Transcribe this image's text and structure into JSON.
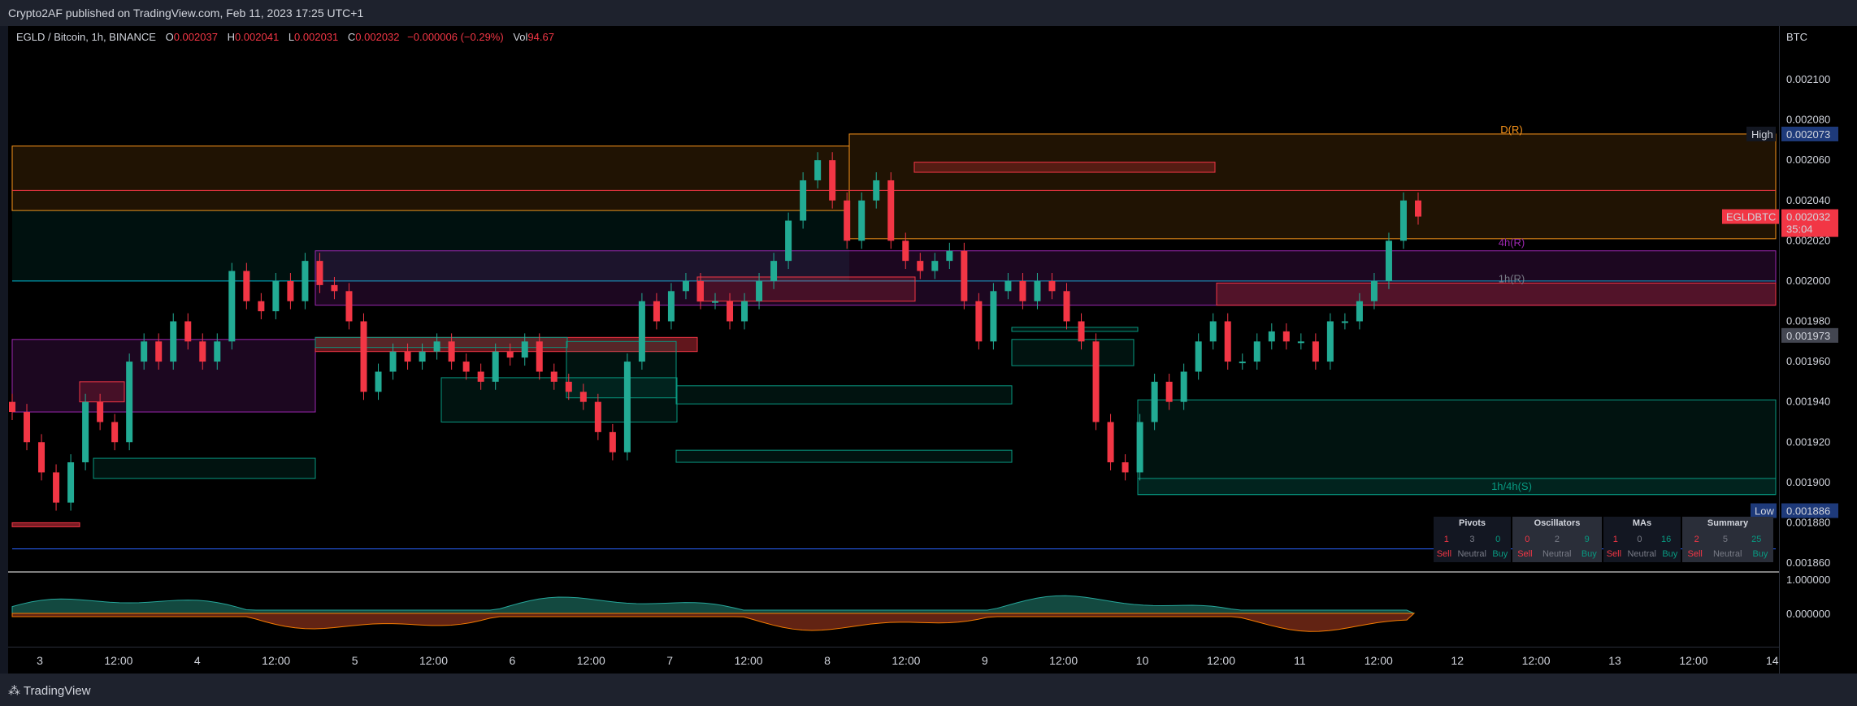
{
  "header": {
    "publisher": "Crypto2AF published on TradingView.com, Feb 11, 2023 17:25 UTC+1"
  },
  "footer": {
    "brand": "TradingView"
  },
  "legend": {
    "symbol": "EGLD / Bitcoin, 1h, BINANCE",
    "o_label": "O",
    "o": "0.002037",
    "h_label": "H",
    "h": "0.002041",
    "l_label": "L",
    "l": "0.002031",
    "c_label": "C",
    "c": "0.002032",
    "chg": "−0.000006 (−0.29%)",
    "vol_label": "Vol",
    "vol": "94.67"
  },
  "axis": {
    "currency": "BTC"
  },
  "markers": {
    "high_label": "High",
    "high_value": "0.002073",
    "low_label": "Low",
    "low_value": "0.001886",
    "last_ticker": "EGLDBTC",
    "last_value": "0.002032",
    "countdown": "35:04",
    "level_value": "0.001973"
  },
  "zones": {
    "d": "D(R)",
    "h4": "4h(R)",
    "h1": "1h(R)",
    "support": "1h/4h(S)"
  },
  "indicator": {
    "upper": "1.000000",
    "lower": "0.000000"
  },
  "ratings": [
    {
      "title": "Pivots",
      "sell": "1",
      "neutral": "3",
      "buy": "0"
    },
    {
      "title": "Oscillators",
      "sell": "0",
      "neutral": "2",
      "buy": "9"
    },
    {
      "title": "MAs",
      "sell": "1",
      "neutral": "0",
      "buy": "16"
    },
    {
      "title": "Summary",
      "sell": "2",
      "neutral": "5",
      "buy": "25"
    }
  ],
  "ratings_labels": {
    "sell": "Sell",
    "neutral": "Neutral",
    "buy": "Buy"
  },
  "colors": {
    "up": "#22ab94",
    "down": "#f23645",
    "resistance": "#f7931a",
    "band": "#9c27b0",
    "support": "#089981"
  },
  "chart_data": {
    "type": "candlestick",
    "price_ticks": [
      "0.002100",
      "0.002080",
      "0.002060",
      "0.002040",
      "0.002020",
      "0.002000",
      "0.001980",
      "0.001960",
      "0.001940",
      "0.001920",
      "0.001900",
      "0.001880",
      "0.001860"
    ],
    "time_ticks": [
      "3",
      "12:00",
      "4",
      "12:00",
      "5",
      "12:00",
      "6",
      "12:00",
      "7",
      "12:00",
      "8",
      "12:00",
      "9",
      "12:00",
      "10",
      "12:00",
      "11",
      "12:00",
      "12",
      "12:00",
      "13",
      "12:00",
      "14"
    ],
    "ylim": [
      0.001848,
      0.002116
    ],
    "closes": [
      0.001935,
      0.00192,
      0.001905,
      0.00189,
      0.00191,
      0.00194,
      0.00193,
      0.00192,
      0.00196,
      0.00197,
      0.00196,
      0.00198,
      0.00197,
      0.00196,
      0.00197,
      0.002005,
      0.00199,
      0.001985,
      0.002,
      0.00199,
      0.00201,
      0.001998,
      0.001995,
      0.00198,
      0.001945,
      0.001955,
      0.001965,
      0.00196,
      0.001965,
      0.00197,
      0.00196,
      0.001955,
      0.00195,
      0.001965,
      0.001962,
      0.00197,
      0.001955,
      0.00195,
      0.001945,
      0.00194,
      0.001925,
      0.001915,
      0.00196,
      0.00199,
      0.00198,
      0.001995,
      0.002,
      0.00199,
      0.00199,
      0.00198,
      0.00199,
      0.002,
      0.00201,
      0.00203,
      0.00205,
      0.00206,
      0.00204,
      0.00202,
      0.00204,
      0.00205,
      0.00202,
      0.00201,
      0.002005,
      0.00201,
      0.002015,
      0.00199,
      0.00197,
      0.001995,
      0.002,
      0.00199,
      0.002,
      0.001995,
      0.00198,
      0.00197,
      0.00193,
      0.00191,
      0.001905,
      0.00193,
      0.00195,
      0.00194,
      0.001955,
      0.00197,
      0.00198,
      0.00196,
      0.00196,
      0.00197,
      0.001975,
      0.00197,
      0.00197,
      0.00196,
      0.00198,
      0.00198,
      0.00199,
      0.002,
      0.00202,
      0.00204,
      0.002032
    ]
  }
}
